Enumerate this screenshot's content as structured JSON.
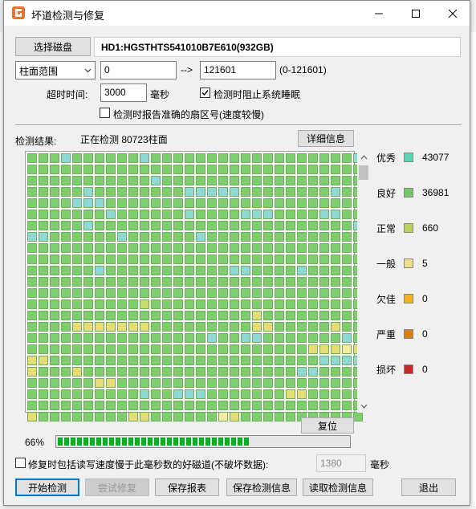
{
  "window": {
    "title": "坏道检测与修复"
  },
  "disk": {
    "select_label": "选择磁盘",
    "name": "HD1:HGSTHTS541010B7E610(932GB)"
  },
  "range": {
    "mode": "柱面范围",
    "start": "0",
    "arrow": "-->",
    "end": "121601",
    "hint": "(0-121601)"
  },
  "timeout": {
    "label": "超时时间:",
    "value": "3000",
    "unit": "毫秒"
  },
  "options": {
    "prevent_sleep": {
      "label": "检测时阻止系统睡眠",
      "checked": true
    },
    "report_sectors": {
      "label": "检测时报告准确的扇区号(速度较慢)",
      "checked": false
    }
  },
  "status": {
    "label": "检测结果:",
    "text": "正在检测 80723柱面",
    "details_button": "详细信息"
  },
  "legend": [
    {
      "label": "优秀",
      "color": "#56d6b6",
      "count": "43077"
    },
    {
      "label": "良好",
      "color": "#77c868",
      "count": "36981"
    },
    {
      "label": "正常",
      "color": "#b8d45e",
      "count": "660"
    },
    {
      "label": "一般",
      "color": "#f0e08a",
      "count": "5"
    },
    {
      "label": "欠佳",
      "color": "#f4b21e",
      "count": "0"
    },
    {
      "label": "严重",
      "color": "#db7e12",
      "count": "0"
    },
    {
      "label": "损坏",
      "color": "#c42a2a",
      "count": "0"
    }
  ],
  "grid": {
    "colors": {
      "G": "#7fce6d",
      "C": "#8fd8d8",
      "Y": "#e8dc74",
      "L": "#c7dd6c",
      "P": "#f5eaa0"
    },
    "rows": [
      "GGGCGGGGGGCGGGGGGGGGGGGGGGGGGC",
      "GGGGGGGGGGGGGGGGGGGGGGGGGGGGGG",
      "GGGGGGGGGGGCGGGGGGGGGGGGGGGGGG",
      "GGGGGCGGGGGGGGCCCCCGGGGGGGGCGG",
      "GGGGCCCGGGGGGGGGGGGGGGGGGGGGGG",
      "GGGGGGGCGGGGGGCGGGGCCCGGGGCCGG",
      "GGGGGCGGGGGGGGGGGGGGGGGGGGGGGC",
      "CCGGGGGGCGGGGGGCGGGGGGGGGGGGGG",
      "GGGGGGGGGGGGGGGGGGGGGGGGGGGGGG",
      "GGGGGGGGGGGGGGGGGGGGGGGGGGGGGG",
      "GGGGGGCGGGGGGGGGGGCCGGGGCGGGGG",
      "GGGGGGGGGGGGGGGGGGGGGGGGGGGGGG",
      "GGGGGGGGGGGGGGGGGGGGGGGGGGGGGG",
      "GGGGGGGGGGLGGGGGGGGGGGGGGGGGGG",
      "GGGGGGGGGGGGGGGGGGGGYGGGGGGGGG",
      "GGGGYYYYYYYGGGGGGGGGYYGGGGGYGG",
      "GGGGGGGGGGGGGGGGCGGCCGGGGGGGCG",
      "GGGGGGGGGGGGGGGGGGGGGGGGGYYYPY",
      "YYGGGGGGGGGGGGGGGGGGGGGGGGCCCC",
      "YGGGYGGGGGGGGGGGGGGGGGGGCCGGGG",
      "GGGGGGYYGGGGGGGGGGGGGGGGGGGGGG",
      "GGGGGGGGGGCGGCCCGGGGGGGYYGGGGG",
      "GGGGGGGGGGGGGGGGGGGGGGGGGGGGGG",
      "YGGGGGGGGYYGGGGGGPYGGGGGGGGGGG"
    ]
  },
  "reset_button": "复位",
  "progress": {
    "percent_text": "66%",
    "value": 0.66
  },
  "repair_option": {
    "label": "修复时包括读写速度慢于此毫秒数的好磁道(不破坏数据):",
    "value": "1380",
    "unit": "毫秒",
    "checked": false
  },
  "actions": {
    "start": "开始检测",
    "try_repair": "尝试修复",
    "save_report": "保存报表",
    "save_info": "保存检测信息",
    "load_info": "读取检测信息",
    "exit": "退出"
  }
}
